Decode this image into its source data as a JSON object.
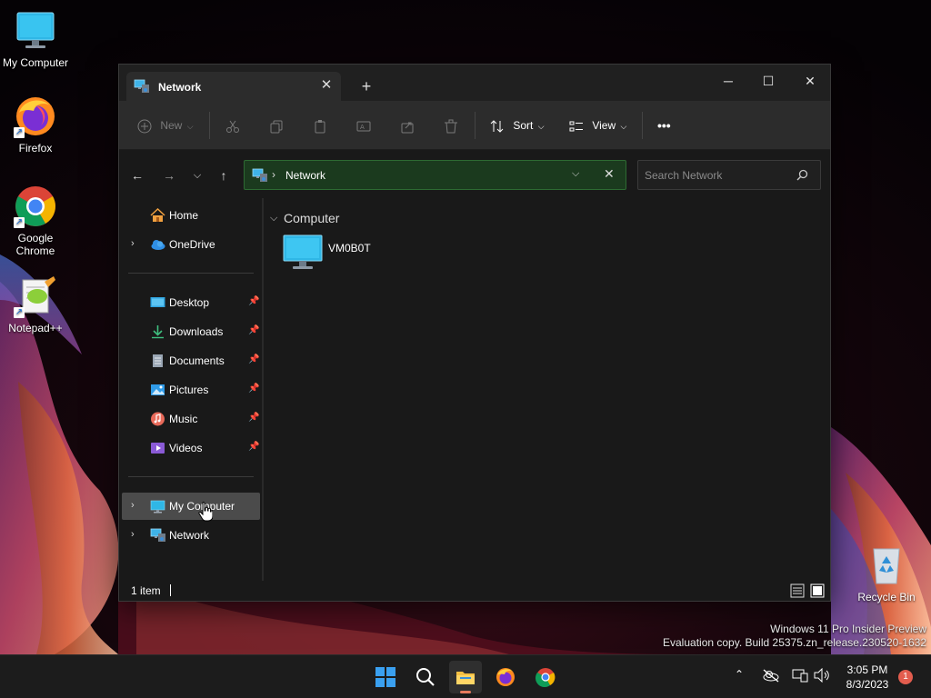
{
  "desktop": {
    "icons": [
      {
        "label": "My Computer",
        "icon": "monitor-icon"
      },
      {
        "label": "Firefox",
        "icon": "firefox-icon"
      },
      {
        "label": "Google Chrome",
        "icon": "chrome-icon"
      },
      {
        "label": "Notepad++",
        "icon": "notepadpp-icon"
      },
      {
        "label": "Recycle Bin",
        "icon": "recycle-bin-icon"
      }
    ]
  },
  "window": {
    "tab_title": "Network",
    "controls": {
      "minimize": "─",
      "maximize": "☐",
      "close": "✕"
    }
  },
  "toolbar": {
    "new_label": "New",
    "sort_label": "Sort",
    "view_label": "View",
    "more_label": "•••",
    "disabled_actions": [
      "cut",
      "copy",
      "paste",
      "rename",
      "share",
      "delete"
    ]
  },
  "address": {
    "path": "Network",
    "search_placeholder": "Search Network"
  },
  "sidebar": {
    "top_items": [
      {
        "label": "Home",
        "icon": "home-icon"
      },
      {
        "label": "OneDrive",
        "icon": "onedrive-icon"
      }
    ],
    "quick_access": [
      {
        "label": "Desktop",
        "icon": "desktop-folder-icon"
      },
      {
        "label": "Downloads",
        "icon": "downloads-icon"
      },
      {
        "label": "Documents",
        "icon": "documents-icon"
      },
      {
        "label": "Pictures",
        "icon": "pictures-icon"
      },
      {
        "label": "Music",
        "icon": "music-icon"
      },
      {
        "label": "Videos",
        "icon": "videos-icon"
      }
    ],
    "bottom_items": [
      {
        "label": "My Computer",
        "icon": "monitor-icon",
        "selected": true
      },
      {
        "label": "Network",
        "icon": "network-icon"
      }
    ]
  },
  "content": {
    "group_title": "Computer",
    "items": [
      {
        "label": "VM0B0T",
        "icon": "monitor-icon"
      }
    ]
  },
  "status": {
    "item_count": "1 item"
  },
  "watermark": {
    "line1": "Windows 11 Pro Insider Preview",
    "line2": "Evaluation copy. Build 25375.zn_release.230520-1632"
  },
  "taskbar": {
    "apps": [
      "start-icon",
      "search-icon",
      "file-explorer-icon",
      "firefox-icon",
      "chrome-icon"
    ],
    "clock_time": "3:05 PM",
    "clock_date": "8/3/2023",
    "notification_count": "1"
  },
  "colors": {
    "accent": "#2d6a32",
    "selection": "#4b4b4b",
    "badge": "#e35d4e"
  }
}
